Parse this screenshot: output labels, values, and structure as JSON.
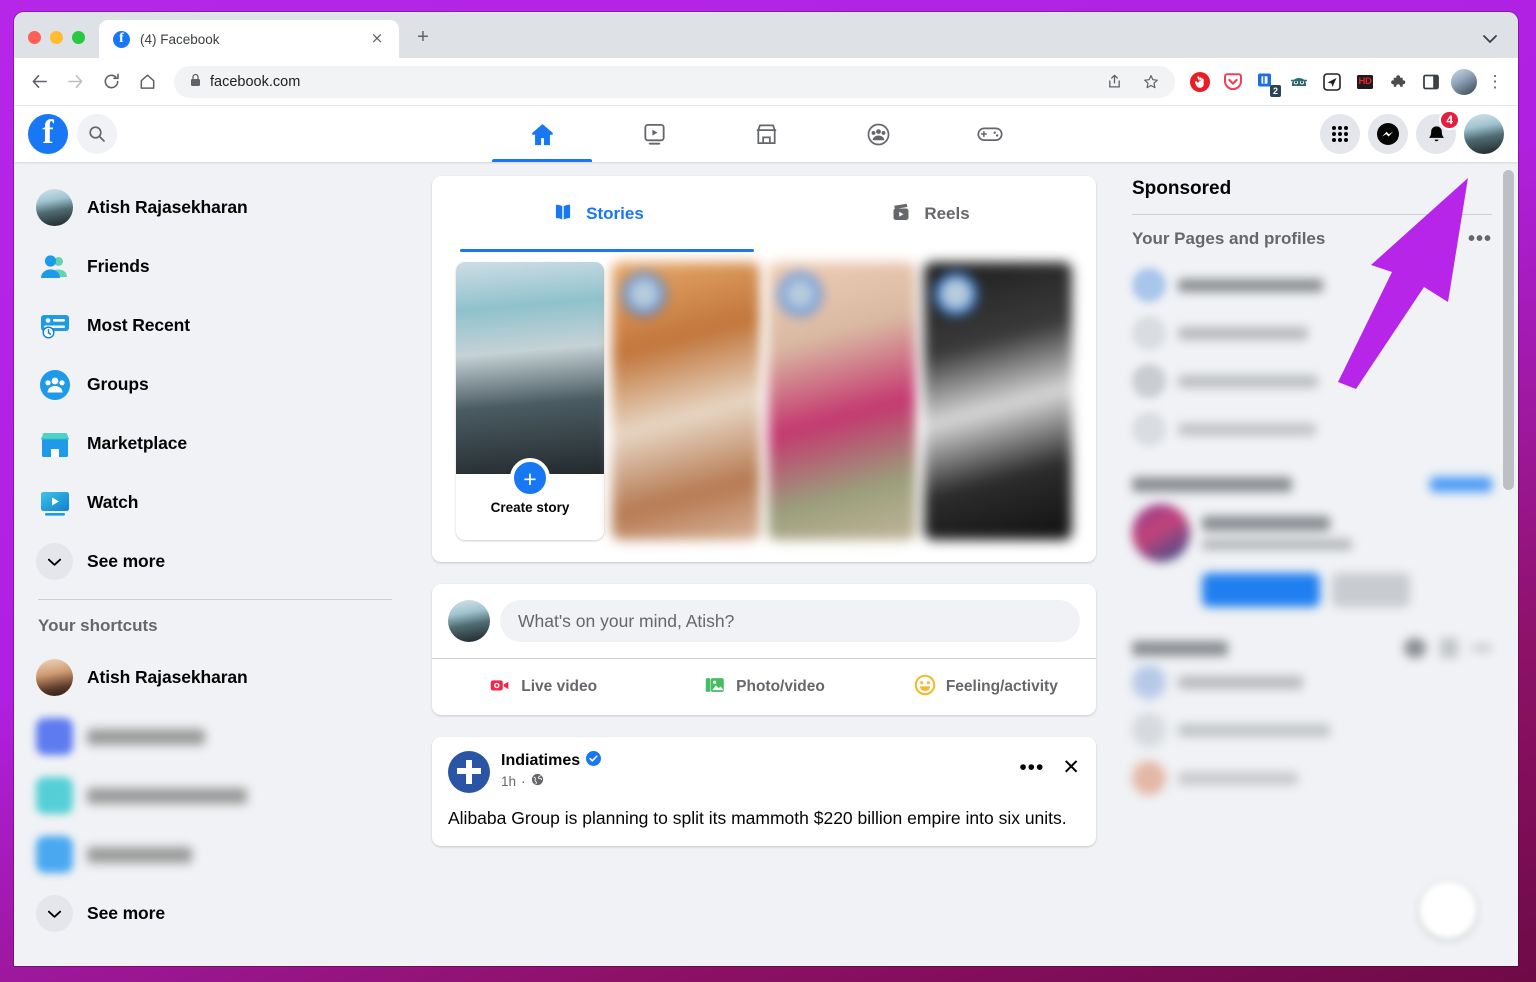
{
  "browser": {
    "tab": {
      "title": "(4) Facebook",
      "favicon": "facebook-icon",
      "close": "×"
    },
    "new_tab": "+",
    "tab_list_chevron": "⌄",
    "nav": {
      "back": "←",
      "forward": "→",
      "reload": "↻",
      "home": "⌂"
    },
    "omnibox": {
      "lock": "🔒",
      "url": "facebook.com",
      "share": "share-icon",
      "bookmark": "☆"
    },
    "extensions": [
      {
        "name": "adblock-extension",
        "label": ""
      },
      {
        "name": "pocket-extension",
        "label": ""
      },
      {
        "name": "notes-extension",
        "label": "2"
      },
      {
        "name": "grammar-extension",
        "label": ""
      },
      {
        "name": "telegram-extension",
        "label": ""
      },
      {
        "name": "hd-video-extension",
        "label": "HD"
      },
      {
        "name": "puzzle-extension",
        "label": ""
      },
      {
        "name": "sidepanel-extension",
        "label": ""
      }
    ],
    "profile_menu": "profile-avatar",
    "chrome_menu": "⋮"
  },
  "facebook": {
    "logo": "f",
    "search_icon": "search-icon",
    "nav_tabs": [
      {
        "name": "home",
        "icon": "home-icon",
        "active": true
      },
      {
        "name": "watch",
        "icon": "video-icon",
        "active": false
      },
      {
        "name": "marketplace",
        "icon": "storefront-icon",
        "active": false
      },
      {
        "name": "groups",
        "icon": "groups-icon",
        "active": false
      },
      {
        "name": "gaming",
        "icon": "gamepad-icon",
        "active": false
      }
    ],
    "right_actions": {
      "menu_icon": "grid-menu-icon",
      "messenger_icon": "messenger-icon",
      "notifications_icon": "bell-icon",
      "notifications_count": "4",
      "account_avatar": "account-avatar"
    },
    "sidebar": {
      "items": [
        {
          "label": "Atish Rajasekharan",
          "icon": "profile-avatar"
        },
        {
          "label": "Friends",
          "icon": "friends-icon"
        },
        {
          "label": "Most Recent",
          "icon": "most-recent-icon"
        },
        {
          "label": "Groups",
          "icon": "groups-icon"
        },
        {
          "label": "Marketplace",
          "icon": "marketplace-icon"
        },
        {
          "label": "Watch",
          "icon": "watch-icon"
        },
        {
          "label": "See more",
          "icon": "chevron-down-icon"
        }
      ],
      "shortcuts_title": "Your shortcuts",
      "shortcuts": [
        {
          "label": "Atish Rajasekharan",
          "blurred": false
        },
        {
          "label": "",
          "blurred": true
        },
        {
          "label": "",
          "blurred": true
        },
        {
          "label": "",
          "blurred": true
        }
      ],
      "shortcuts_see_more": "See more"
    },
    "stories": {
      "tabs": [
        {
          "label": "Stories",
          "icon": "stories-icon",
          "active": true
        },
        {
          "label": "Reels",
          "icon": "reels-icon",
          "active": false
        }
      ],
      "create_story_label": "Create story",
      "create_plus": "+",
      "tiles": [
        "story-tile-1",
        "story-tile-2",
        "story-tile-3"
      ]
    },
    "composer": {
      "placeholder": "What's on your mind, Atish?",
      "actions": [
        {
          "label": "Live video",
          "icon": "live-video-icon"
        },
        {
          "label": "Photo/video",
          "icon": "photo-video-icon"
        },
        {
          "label": "Feeling/activity",
          "icon": "feeling-icon"
        }
      ]
    },
    "post": {
      "author": "Indiatimes",
      "verified": "✓",
      "time": "1h",
      "audience_icon": "globe-icon",
      "separator": "·",
      "more_icon": "•••",
      "close_icon": "✕",
      "text": "Alibaba Group is planning to split its mammoth $220 billion empire into six units."
    },
    "right_rail": {
      "sponsored_title": "Sponsored",
      "pages_title": "Your Pages and profiles",
      "pages_more": "•••",
      "blurred_rows": 4,
      "blurred_sections": 2
    }
  },
  "annotation": {
    "arrow_color": "#b726e8",
    "points_to": "account-avatar"
  },
  "colors": {
    "facebook_blue": "#1877f2",
    "badge_red": "#e41e3f",
    "page_bg": "#f0f2f5",
    "card_bg": "#ffffff",
    "frame_purple": "#b626e8"
  }
}
